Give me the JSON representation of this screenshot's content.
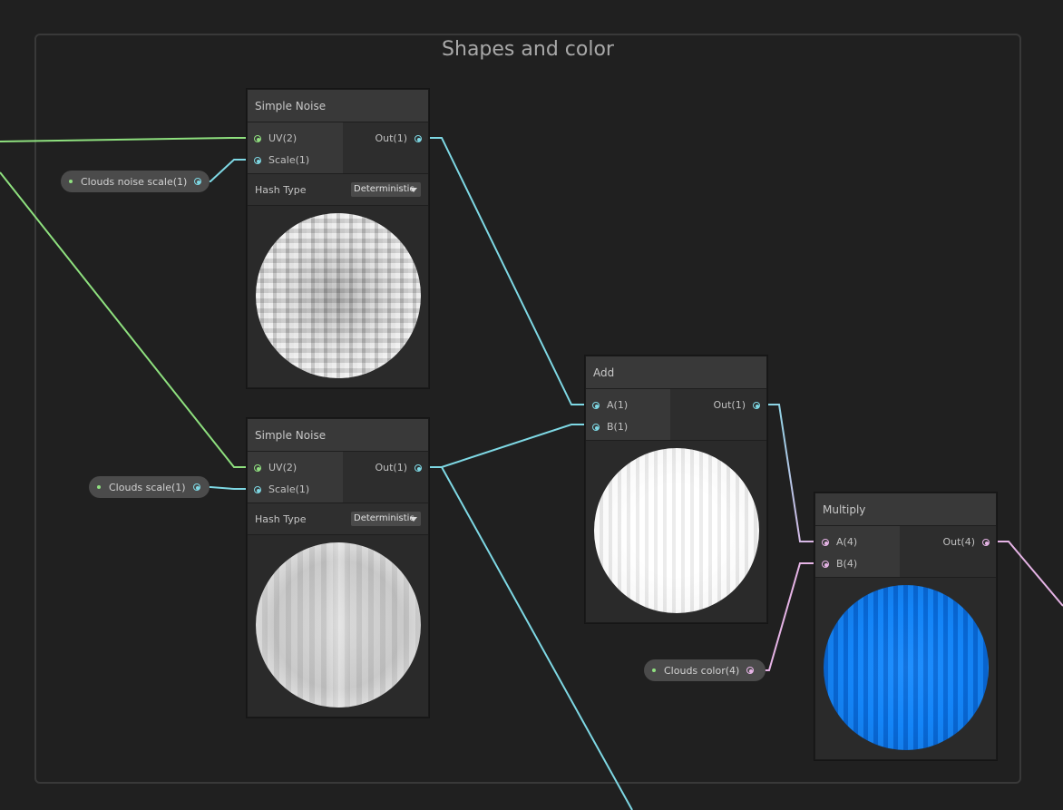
{
  "group": {
    "title": "Shapes and color"
  },
  "nodes": {
    "noise_top": {
      "title": "Simple Noise",
      "inputs": [
        "UV(2)",
        "Scale(1)"
      ],
      "output": "Out(1)",
      "field_label": "Hash Type",
      "field_value": "Deterministic"
    },
    "noise_bottom": {
      "title": "Simple Noise",
      "inputs": [
        "UV(2)",
        "Scale(1)"
      ],
      "output": "Out(1)",
      "field_label": "Hash Type",
      "field_value": "Deterministic"
    },
    "add": {
      "title": "Add",
      "inputs": [
        "A(1)",
        "B(1)"
      ],
      "output": "Out(1)"
    },
    "multiply": {
      "title": "Multiply",
      "inputs": [
        "A(4)",
        "B(4)"
      ],
      "output": "Out(4)"
    }
  },
  "properties": {
    "noise_scale": "Clouds noise scale(1)",
    "clouds_scale": "Clouds scale(1)",
    "clouds_color": "Clouds color(4)"
  },
  "colors": {
    "wire_uv": "#8ee07e",
    "wire_float": "#7ed8e4",
    "wire_vector4": "#e6b4e6",
    "clouds_color": "#0a84ff"
  }
}
